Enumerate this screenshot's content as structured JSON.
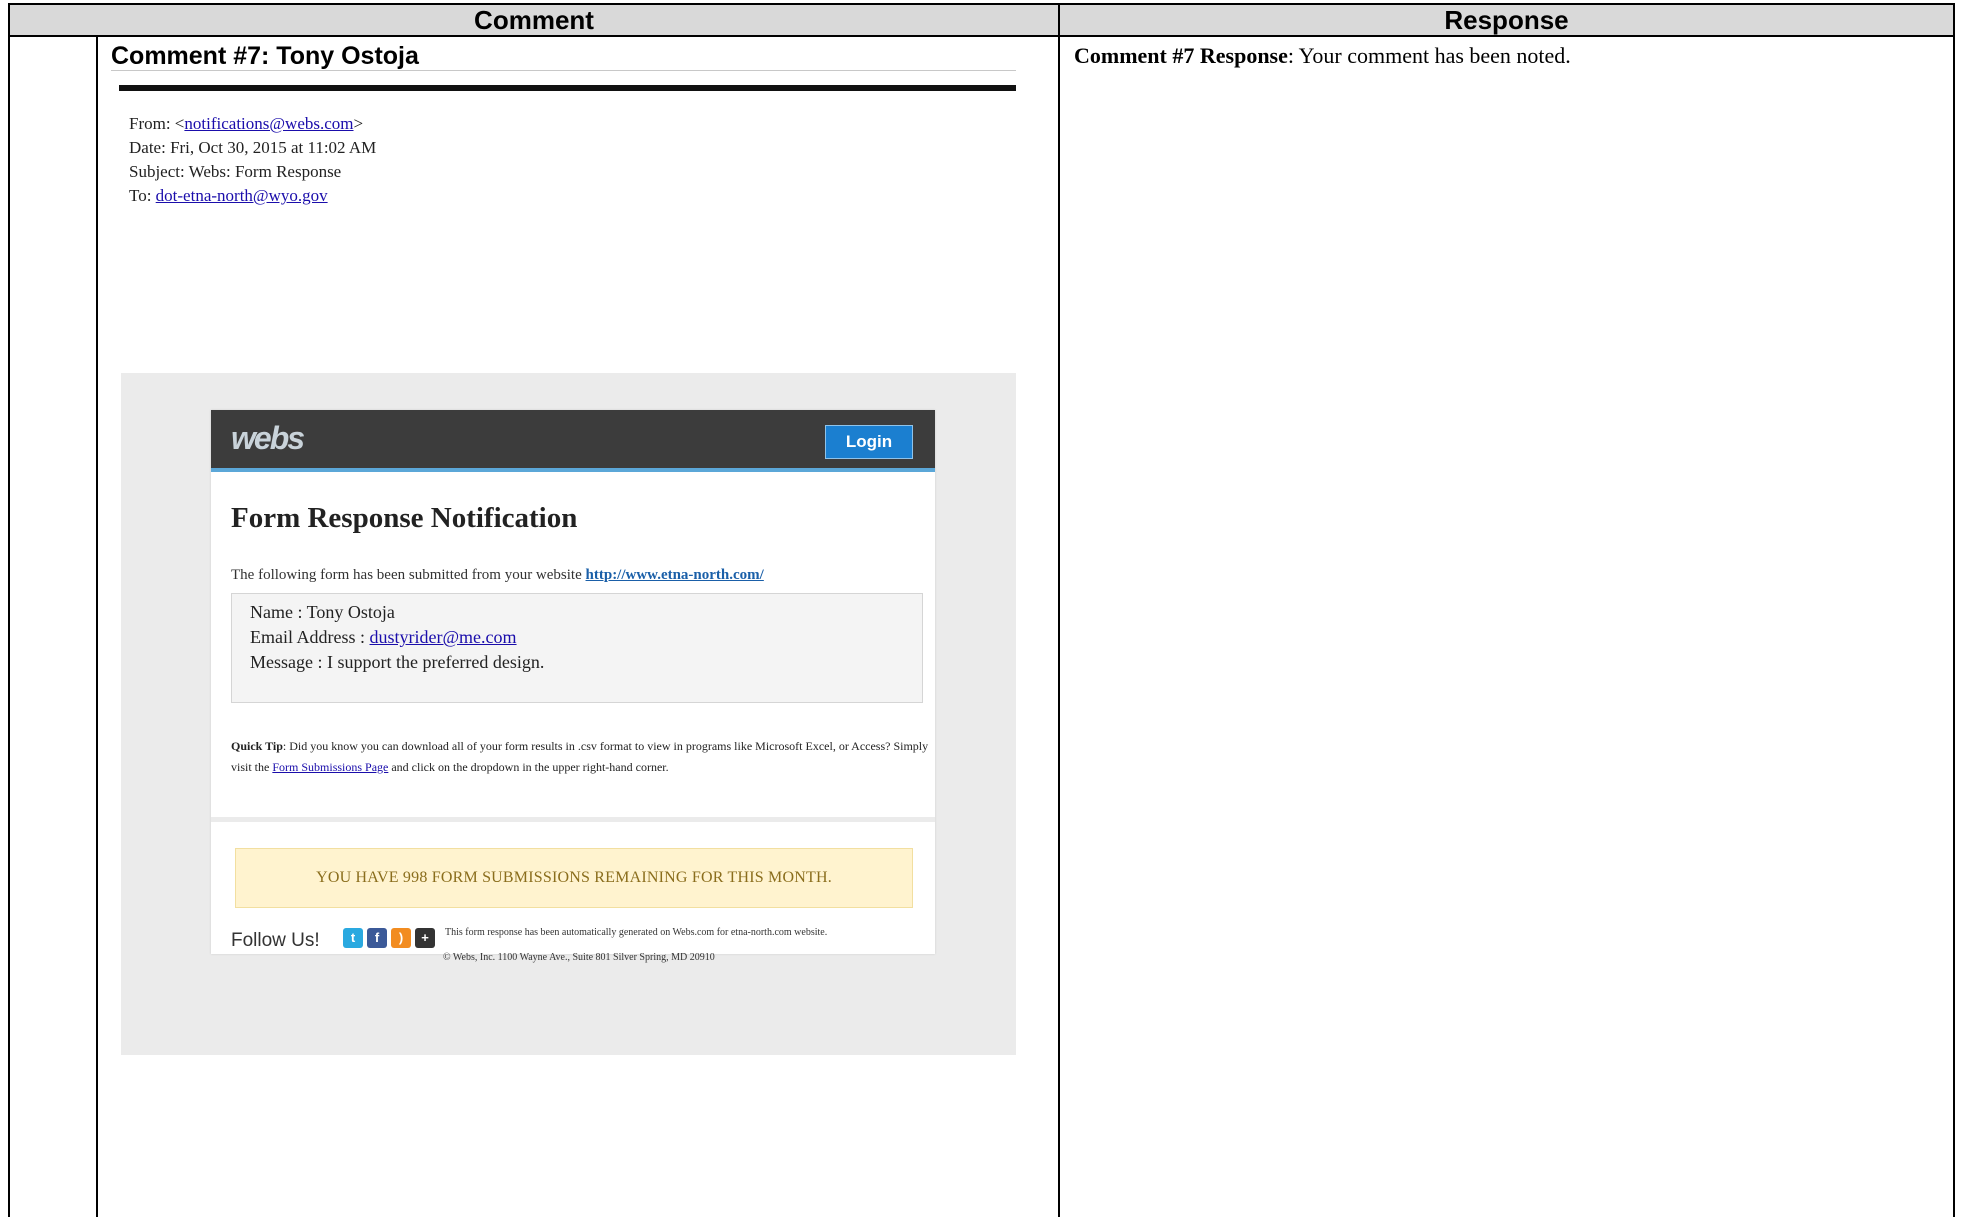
{
  "table": {
    "header_comment": "Comment",
    "header_response": "Response"
  },
  "comment": {
    "title": "Comment #7:  Tony Ostoja"
  },
  "response": {
    "label": "Comment #7 Response",
    "text": ":  Your comment has been noted."
  },
  "email": {
    "from_label": "From: <",
    "from_addr": "notifications@webs.com",
    "from_close": ">",
    "date": "Date: Fri, Oct 30, 2015 at 11:02 AM",
    "subject": "Subject: Webs: Form Response",
    "to_label": "To: ",
    "to_addr": "dot-etna-north@wyo.gov"
  },
  "card": {
    "logo": "webs",
    "login": "Login",
    "title": "Form Response Notification",
    "intro": "The following form has been submitted from your website ",
    "intro_link": "http://www.etna-north.com/",
    "fields": {
      "name": "Name : Tony Ostoja",
      "email_label": "Email Address : ",
      "email_value": "dustyrider@me.com",
      "message": "Message : I support the preferred design."
    },
    "tip_label": "Quick Tip",
    "tip_text_1": ": Did you know you can download all of your form results in .csv format to view in programs like Microsoft Excel, or Access? Simply visit the ",
    "tip_link": "Form Submissions Page",
    "tip_text_2": " and click on the dropdown in the upper right-hand corner.",
    "quota": "YOU HAVE 998 FORM SUBMISSIONS REMAINING FOR THIS MONTH.",
    "follow": "Follow Us!",
    "social_icons": [
      "twitter-icon",
      "facebook-icon",
      "rss-icon",
      "plus-icon"
    ],
    "footer_1": "This form response has been automatically generated on Webs.com for etna-north.com website.",
    "footer_2": "© Webs, Inc. 1100 Wayne Ave., Suite 801 Silver Spring, MD 20910"
  }
}
